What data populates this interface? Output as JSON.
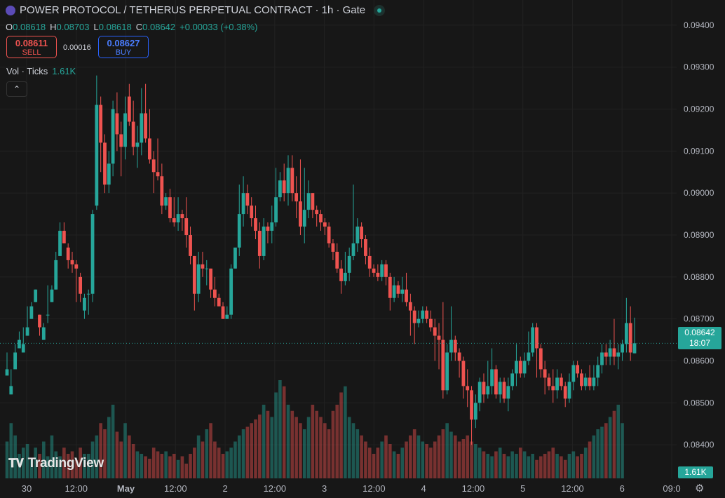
{
  "header": {
    "title": "POWER PROTOCOL / TETHERUS PERPETUAL CONTRACT · 1h · Gate",
    "ohlc": [
      {
        "k": "O",
        "v": "0.08618"
      },
      {
        "k": "H",
        "v": "0.08703"
      },
      {
        "k": "L",
        "v": "0.08618"
      },
      {
        "k": "C",
        "v": "0.08642"
      },
      {
        "k": "",
        "v": "+0.00033 (+0.38%)"
      }
    ],
    "sell_price": "0.08611",
    "sell_label": "SELL",
    "spread": "0.00016",
    "buy_price": "0.08627",
    "buy_label": "BUY",
    "vol_label": "Vol · Ticks",
    "vol_value": "1.61K",
    "collapse_icon": "chevron-up-icon"
  },
  "price_tag": {
    "price": "0.08642",
    "countdown": "18:07"
  },
  "vol_tag": "1.61K",
  "branding": "TradingView",
  "colors": {
    "up": "#26a69a",
    "down": "#ef5350",
    "bg": "#171717",
    "grid": "#222222",
    "text": "#b2b5be"
  },
  "chart_data": {
    "type": "candlestick",
    "y_ticks": [
      "0.09400",
      "0.09300",
      "0.09200",
      "0.09100",
      "0.09000",
      "0.08900",
      "0.08800",
      "0.08700",
      "0.08600",
      "0.08500",
      "0.08400"
    ],
    "ylim": [
      0.0832,
      0.0946
    ],
    "x_ticks": [
      "30",
      "12:00",
      "May",
      "12:00",
      "2",
      "12:00",
      "3",
      "12:00",
      "4",
      "12:00",
      "5",
      "12:00",
      "6",
      "09:0"
    ],
    "last_price": 0.08642,
    "current_price_line": 0.08642,
    "candles": [
      [
        0.08565,
        0.0858,
        0.08565,
        0.0862
      ],
      [
        0.0852,
        0.0854,
        0.0858,
        0.0852
      ],
      [
        0.0858,
        0.0862,
        0.086,
        0.0864
      ],
      [
        0.0863,
        0.0865,
        0.0863,
        0.0867
      ],
      [
        0.0862,
        0.0864,
        0.0862,
        0.0868
      ],
      [
        0.0866,
        0.0868,
        0.0866,
        0.0873
      ],
      [
        0.087,
        0.0873,
        0.087,
        0.0874
      ],
      [
        0.0874,
        0.0877,
        0.0874,
        0.0877
      ],
      [
        0.0871,
        0.0868,
        0.0866,
        0.0871
      ],
      [
        0.0865,
        0.0868,
        0.0865,
        0.0869
      ],
      [
        0.0871,
        0.0871,
        0.0869,
        0.0878
      ],
      [
        0.0874,
        0.0877,
        0.0874,
        0.0878
      ],
      [
        0.0877,
        0.0884,
        0.0877,
        0.0886
      ],
      [
        0.0885,
        0.0891,
        0.0885,
        0.0893
      ],
      [
        0.0891,
        0.0888,
        0.0888,
        0.0893
      ],
      [
        0.0887,
        0.0884,
        0.0882,
        0.0888
      ],
      [
        0.0884,
        0.0883,
        0.0881,
        0.0886
      ],
      [
        0.0883,
        0.0882,
        0.0874,
        0.0884
      ],
      [
        0.088,
        0.0876,
        0.0874,
        0.0881
      ],
      [
        0.0872,
        0.0875,
        0.087,
        0.0876
      ],
      [
        0.0876,
        0.0876,
        0.0871,
        0.0877
      ],
      [
        0.0876,
        0.0895,
        0.0874,
        0.0896
      ],
      [
        0.0897,
        0.0921,
        0.0896,
        0.0928
      ],
      [
        0.0921,
        0.0912,
        0.0905,
        0.0923
      ],
      [
        0.0912,
        0.0902,
        0.09,
        0.0914
      ],
      [
        0.0902,
        0.0907,
        0.09,
        0.091
      ],
      [
        0.0907,
        0.092,
        0.0904,
        0.0922
      ],
      [
        0.0919,
        0.0914,
        0.091,
        0.0924
      ],
      [
        0.0914,
        0.0911,
        0.0904,
        0.0917
      ],
      [
        0.0911,
        0.0919,
        0.0908,
        0.0923
      ],
      [
        0.0923,
        0.0917,
        0.0916,
        0.0926
      ],
      [
        0.0917,
        0.0911,
        0.0909,
        0.0922
      ],
      [
        0.0911,
        0.0912,
        0.0906,
        0.0916
      ],
      [
        0.0912,
        0.0919,
        0.0909,
        0.0925
      ],
      [
        0.0919,
        0.0913,
        0.0912,
        0.0926
      ],
      [
        0.0913,
        0.0908,
        0.0907,
        0.092
      ],
      [
        0.0908,
        0.0905,
        0.09,
        0.091
      ],
      [
        0.0905,
        0.0904,
        0.0903,
        0.0913
      ],
      [
        0.0904,
        0.0897,
        0.0895,
        0.0907
      ],
      [
        0.0897,
        0.0899,
        0.0896,
        0.09
      ],
      [
        0.0899,
        0.0894,
        0.0893,
        0.0901
      ],
      [
        0.0894,
        0.0893,
        0.0892,
        0.0899
      ],
      [
        0.0893,
        0.0895,
        0.0891,
        0.0899
      ],
      [
        0.0895,
        0.0894,
        0.0891,
        0.0896
      ],
      [
        0.0894,
        0.089,
        0.0887,
        0.0899
      ],
      [
        0.089,
        0.0885,
        0.0883,
        0.0892
      ],
      [
        0.0885,
        0.0876,
        0.0872,
        0.0885
      ],
      [
        0.0876,
        0.0883,
        0.0874,
        0.0886
      ],
      [
        0.0883,
        0.0882,
        0.088,
        0.0886
      ],
      [
        0.0882,
        0.0882,
        0.0878,
        0.0884
      ],
      [
        0.0882,
        0.0877,
        0.0875,
        0.0882
      ],
      [
        0.0877,
        0.0875,
        0.0873,
        0.088
      ],
      [
        0.0875,
        0.0873,
        0.0873,
        0.0876
      ],
      [
        0.0873,
        0.087,
        0.087,
        0.0874
      ],
      [
        0.087,
        0.0871,
        0.087,
        0.0873
      ],
      [
        0.0871,
        0.0882,
        0.087,
        0.0883
      ],
      [
        0.0882,
        0.0887,
        0.0882,
        0.0887
      ],
      [
        0.0887,
        0.0895,
        0.0885,
        0.0902
      ],
      [
        0.0895,
        0.09,
        0.0892,
        0.0904
      ],
      [
        0.09,
        0.0897,
        0.0895,
        0.0902
      ],
      [
        0.0897,
        0.0894,
        0.0892,
        0.0899
      ],
      [
        0.0894,
        0.0891,
        0.0889,
        0.0897
      ],
      [
        0.0891,
        0.0885,
        0.0882,
        0.0893
      ],
      [
        0.0885,
        0.0892,
        0.0884,
        0.0894
      ],
      [
        0.0892,
        0.0891,
        0.0888,
        0.0893
      ],
      [
        0.0891,
        0.0893,
        0.0888,
        0.0897
      ],
      [
        0.0893,
        0.0899,
        0.0892,
        0.0906
      ],
      [
        0.0899,
        0.0903,
        0.0898,
        0.0905
      ],
      [
        0.0903,
        0.09,
        0.0898,
        0.0907
      ],
      [
        0.09,
        0.0906,
        0.0897,
        0.0909
      ],
      [
        0.0906,
        0.09,
        0.0898,
        0.0909
      ],
      [
        0.09,
        0.0898,
        0.0894,
        0.0904
      ],
      [
        0.0898,
        0.0892,
        0.089,
        0.0908
      ],
      [
        0.0892,
        0.0896,
        0.0888,
        0.0906
      ],
      [
        0.0896,
        0.09,
        0.0894,
        0.0903
      ],
      [
        0.09,
        0.0896,
        0.0894,
        0.09
      ],
      [
        0.0896,
        0.0895,
        0.0892,
        0.0897
      ],
      [
        0.0895,
        0.0893,
        0.0891,
        0.0896
      ],
      [
        0.0893,
        0.0892,
        0.089,
        0.0894
      ],
      [
        0.0892,
        0.0888,
        0.0887,
        0.0893
      ],
      [
        0.0888,
        0.0886,
        0.0884,
        0.0889
      ],
      [
        0.0886,
        0.0882,
        0.0881,
        0.0888
      ],
      [
        0.0882,
        0.0879,
        0.0876,
        0.0884
      ],
      [
        0.0879,
        0.0881,
        0.0878,
        0.0886
      ],
      [
        0.0881,
        0.0885,
        0.0879,
        0.0887
      ],
      [
        0.0885,
        0.0888,
        0.0884,
        0.0902
      ],
      [
        0.0888,
        0.0892,
        0.0886,
        0.0894
      ],
      [
        0.0892,
        0.0889,
        0.0887,
        0.0893
      ],
      [
        0.0889,
        0.0885,
        0.0883,
        0.089
      ],
      [
        0.0885,
        0.0882,
        0.088,
        0.0887
      ],
      [
        0.0882,
        0.0881,
        0.088,
        0.0883
      ],
      [
        0.0881,
        0.088,
        0.0879,
        0.0883
      ],
      [
        0.088,
        0.0883,
        0.0879,
        0.0884
      ],
      [
        0.0883,
        0.088,
        0.0878,
        0.0884
      ],
      [
        0.088,
        0.0875,
        0.0872,
        0.0881
      ],
      [
        0.0875,
        0.0878,
        0.0874,
        0.088
      ],
      [
        0.0878,
        0.0876,
        0.0875,
        0.0879
      ],
      [
        0.0876,
        0.0877,
        0.0874,
        0.088
      ],
      [
        0.0877,
        0.0874,
        0.0873,
        0.0881
      ],
      [
        0.0874,
        0.0872,
        0.0866,
        0.0876
      ],
      [
        0.0872,
        0.0869,
        0.0864,
        0.0873
      ],
      [
        0.0869,
        0.087,
        0.0868,
        0.0872
      ],
      [
        0.087,
        0.0872,
        0.0869,
        0.0873
      ],
      [
        0.0872,
        0.087,
        0.0869,
        0.0873
      ],
      [
        0.087,
        0.0868,
        0.0867,
        0.0872
      ],
      [
        0.0868,
        0.0866,
        0.086,
        0.087
      ],
      [
        0.0866,
        0.0865,
        0.0858,
        0.0869
      ],
      [
        0.0865,
        0.0853,
        0.0851,
        0.0874
      ],
      [
        0.0853,
        0.0862,
        0.0852,
        0.0864
      ],
      [
        0.0862,
        0.0865,
        0.086,
        0.0873
      ],
      [
        0.0865,
        0.0862,
        0.086,
        0.0866
      ],
      [
        0.0862,
        0.086,
        0.0856,
        0.0863
      ],
      [
        0.086,
        0.0854,
        0.0851,
        0.0861
      ],
      [
        0.0854,
        0.0853,
        0.0849,
        0.0858
      ],
      [
        0.0853,
        0.0846,
        0.084,
        0.0854
      ],
      [
        0.0846,
        0.085,
        0.0844,
        0.0852
      ],
      [
        0.085,
        0.0855,
        0.0848,
        0.0856
      ],
      [
        0.0855,
        0.0852,
        0.085,
        0.0857
      ],
      [
        0.0852,
        0.0854,
        0.0851,
        0.086
      ],
      [
        0.0854,
        0.0858,
        0.0852,
        0.0863
      ],
      [
        0.0858,
        0.0852,
        0.0851,
        0.0859
      ],
      [
        0.0852,
        0.0855,
        0.085,
        0.0856
      ],
      [
        0.0855,
        0.0851,
        0.085,
        0.0856
      ],
      [
        0.0851,
        0.0854,
        0.0848,
        0.0856
      ],
      [
        0.0854,
        0.0857,
        0.0853,
        0.0858
      ],
      [
        0.0857,
        0.086,
        0.0854,
        0.0864
      ],
      [
        0.086,
        0.0857,
        0.0856,
        0.0861
      ],
      [
        0.0857,
        0.086,
        0.0856,
        0.0862
      ],
      [
        0.086,
        0.0862,
        0.0859,
        0.0867
      ],
      [
        0.0862,
        0.0868,
        0.0861,
        0.0869
      ],
      [
        0.0868,
        0.0863,
        0.0856,
        0.0869
      ],
      [
        0.0863,
        0.0858,
        0.0856,
        0.0864
      ],
      [
        0.0858,
        0.0856,
        0.0852,
        0.086
      ],
      [
        0.0856,
        0.0854,
        0.0853,
        0.0857
      ],
      [
        0.0854,
        0.0853,
        0.085,
        0.0858
      ],
      [
        0.0853,
        0.0856,
        0.0851,
        0.0858
      ],
      [
        0.0856,
        0.0854,
        0.0853,
        0.0857
      ],
      [
        0.0854,
        0.0851,
        0.0849,
        0.0855
      ],
      [
        0.0851,
        0.0855,
        0.085,
        0.0857
      ],
      [
        0.0855,
        0.0859,
        0.0853,
        0.086
      ],
      [
        0.0859,
        0.0857,
        0.0856,
        0.086
      ],
      [
        0.0857,
        0.0854,
        0.0853,
        0.0858
      ],
      [
        0.0854,
        0.0856,
        0.0853,
        0.0857
      ],
      [
        0.0856,
        0.0854,
        0.0853,
        0.0859
      ],
      [
        0.0854,
        0.0856,
        0.0853,
        0.0859
      ],
      [
        0.0856,
        0.0859,
        0.0854,
        0.0861
      ],
      [
        0.0859,
        0.0862,
        0.0857,
        0.0864
      ],
      [
        0.0862,
        0.0861,
        0.0859,
        0.0864
      ],
      [
        0.0861,
        0.0863,
        0.0859,
        0.0865
      ],
      [
        0.0863,
        0.0861,
        0.0859,
        0.087
      ],
      [
        0.0861,
        0.0862,
        0.0858,
        0.0864
      ],
      [
        0.0862,
        0.0864,
        0.086,
        0.0865
      ],
      [
        0.0864,
        0.0869,
        0.0862,
        0.0875
      ],
      [
        0.0869,
        0.0862,
        0.086,
        0.0873
      ],
      [
        0.08618,
        0.08642,
        0.08618,
        0.08703
      ]
    ],
    "volume": [
      0.3,
      0.45,
      0.35,
      0.2,
      0.25,
      0.28,
      0.15,
      0.25,
      0.2,
      0.3,
      0.18,
      0.35,
      0.22,
      0.18,
      0.25,
      0.2,
      0.22,
      0.15,
      0.25,
      0.2,
      0.2,
      0.3,
      0.35,
      0.45,
      0.4,
      0.5,
      0.6,
      0.38,
      0.3,
      0.45,
      0.35,
      0.28,
      0.22,
      0.2,
      0.18,
      0.16,
      0.25,
      0.22,
      0.2,
      0.22,
      0.18,
      0.2,
      0.15,
      0.18,
      0.12,
      0.2,
      0.25,
      0.35,
      0.3,
      0.4,
      0.45,
      0.3,
      0.25,
      0.2,
      0.22,
      0.25,
      0.3,
      0.35,
      0.4,
      0.42,
      0.45,
      0.48,
      0.52,
      0.6,
      0.55,
      0.5,
      0.7,
      0.8,
      0.75,
      0.6,
      0.55,
      0.5,
      0.45,
      0.4,
      0.5,
      0.6,
      0.55,
      0.5,
      0.45,
      0.4,
      0.55,
      0.6,
      0.7,
      0.75,
      0.5,
      0.45,
      0.4,
      0.35,
      0.3,
      0.25,
      0.2,
      0.25,
      0.3,
      0.35,
      0.28,
      0.22,
      0.2,
      0.25,
      0.3,
      0.35,
      0.4,
      0.35,
      0.3,
      0.28,
      0.25,
      0.3,
      0.35,
      0.4,
      0.45,
      0.38,
      0.35,
      0.3,
      0.32,
      0.35,
      0.3,
      0.28,
      0.25,
      0.22,
      0.2,
      0.18,
      0.22,
      0.25,
      0.2,
      0.18,
      0.22,
      0.2,
      0.25,
      0.22,
      0.18,
      0.2,
      0.15,
      0.18,
      0.2,
      0.22,
      0.25,
      0.2,
      0.18,
      0.15,
      0.2,
      0.22,
      0.18,
      0.2,
      0.25,
      0.3,
      0.35,
      0.4,
      0.42,
      0.45,
      0.5,
      0.55,
      0.6,
      0.45
    ]
  }
}
